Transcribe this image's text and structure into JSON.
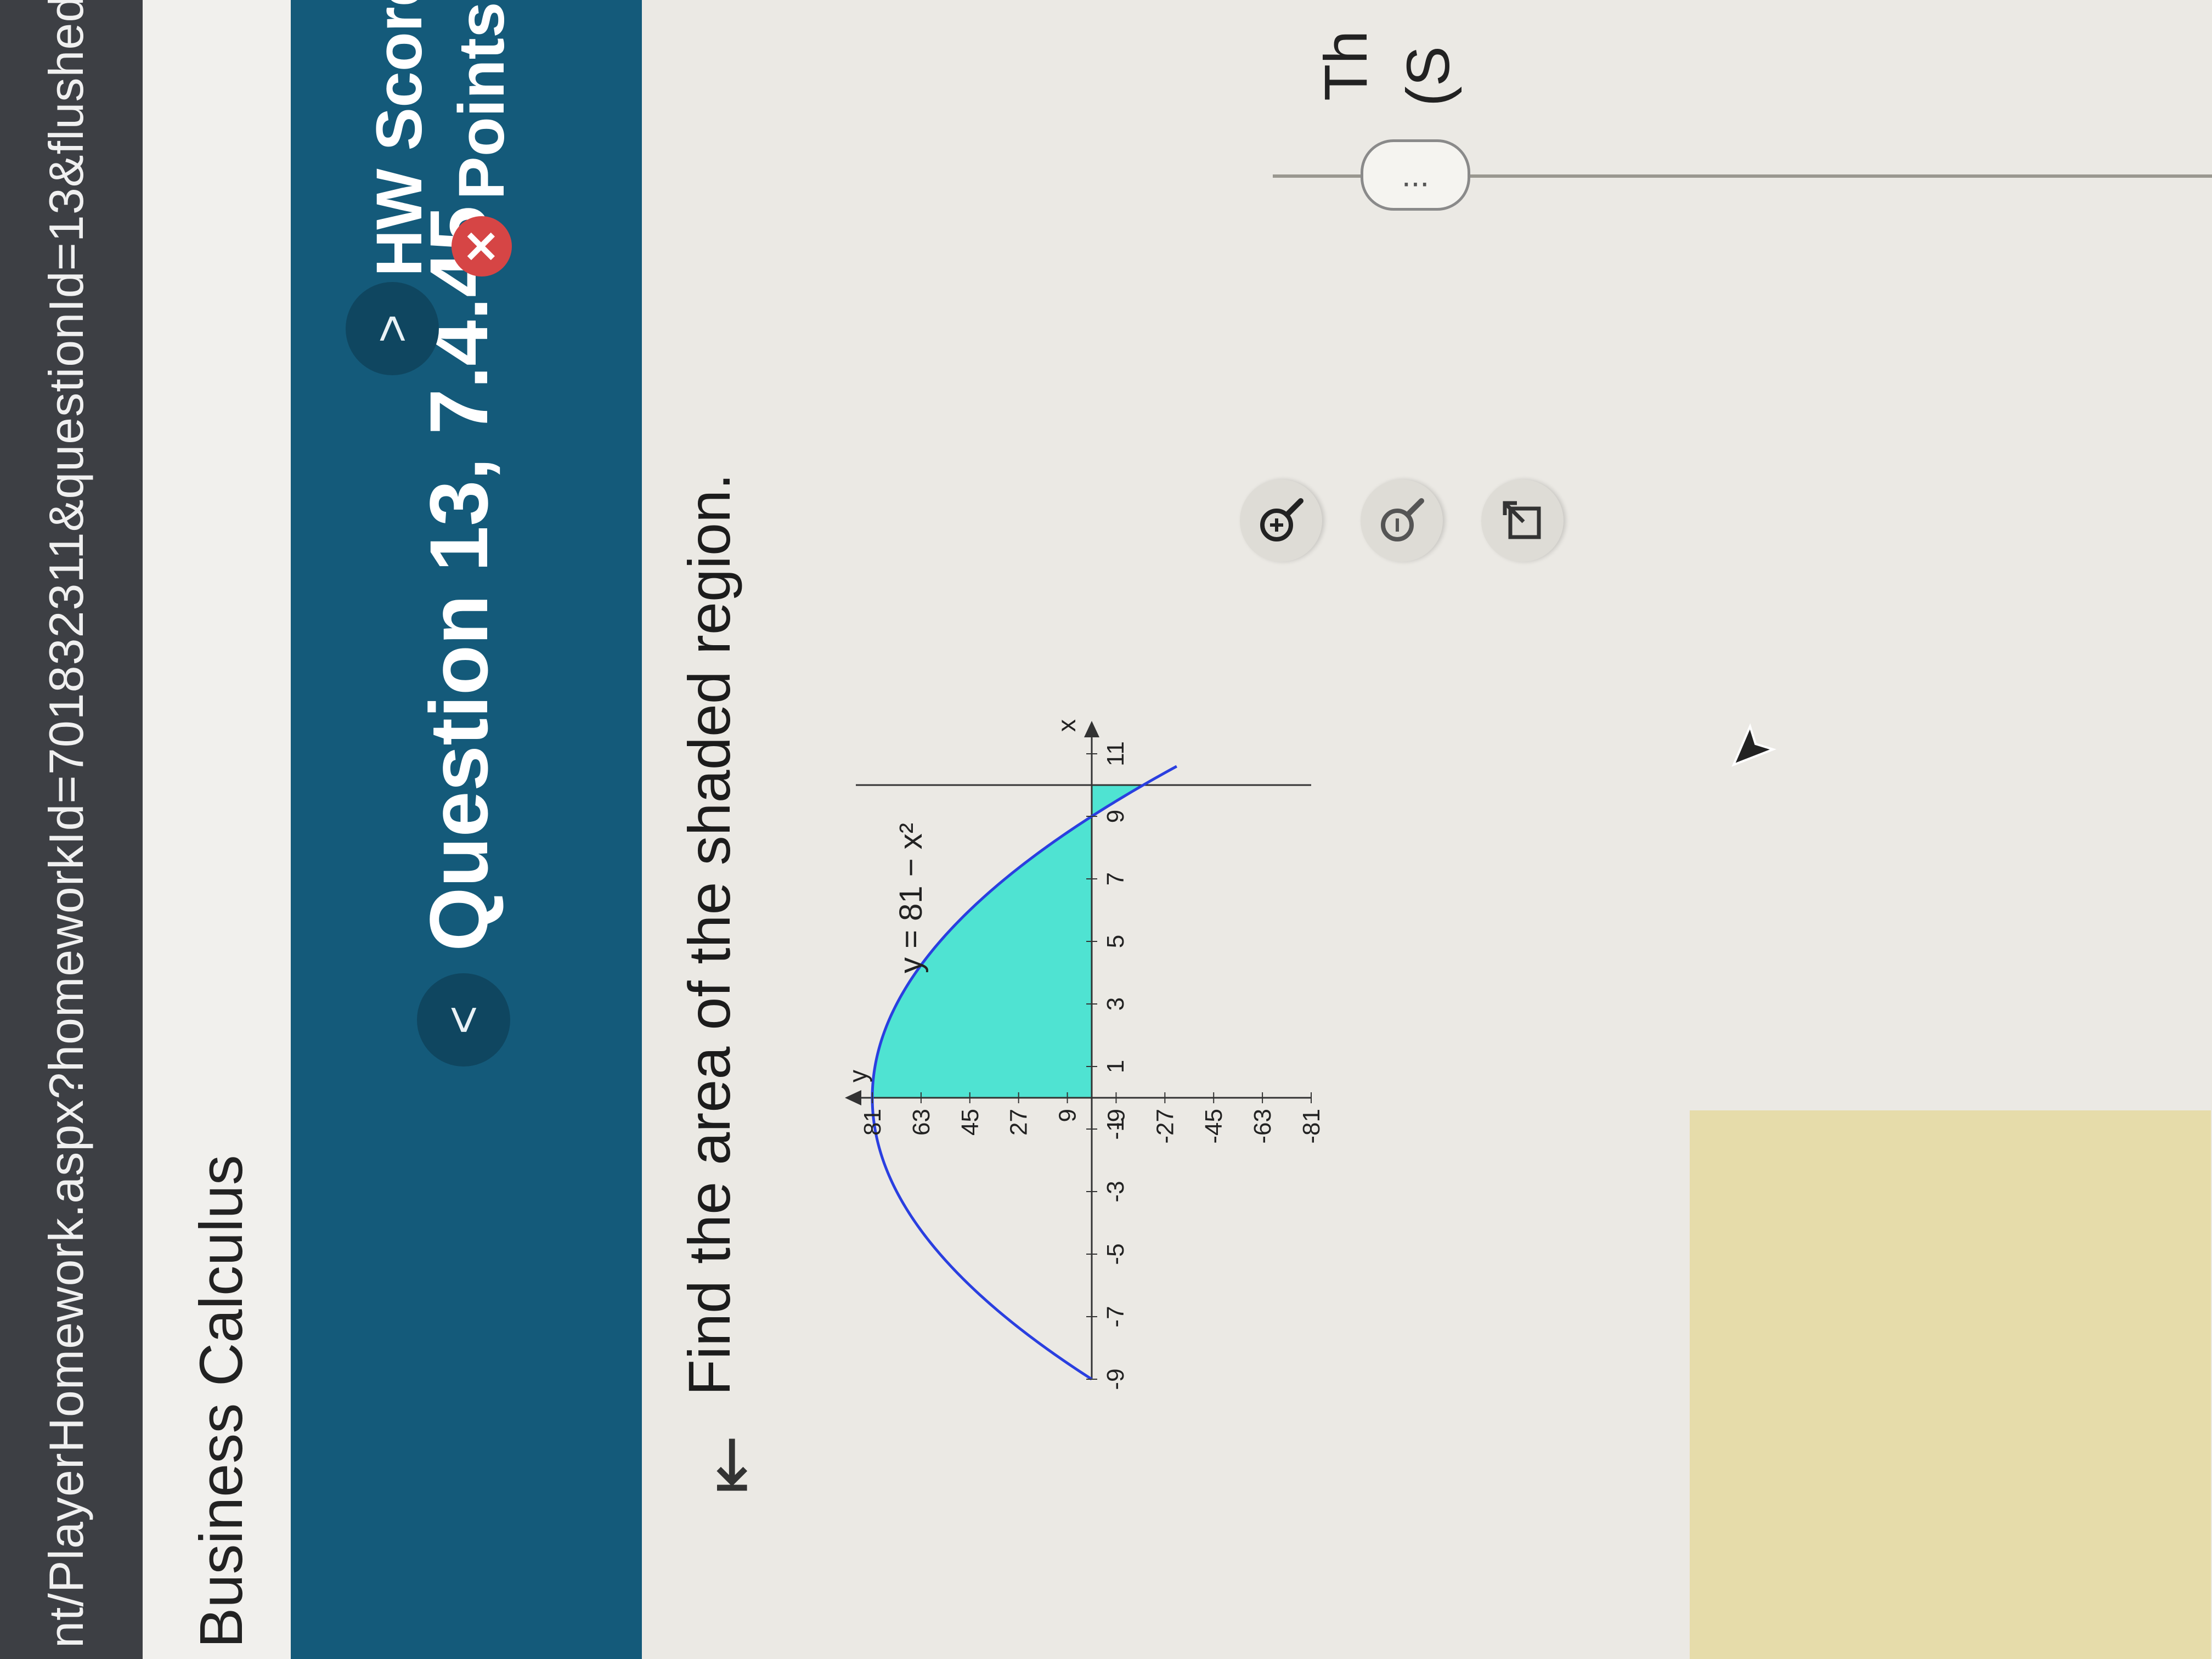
{
  "browser": {
    "url": "nt/PlayerHomework.aspx?homeworkId=701832311&questionId=13&flushed"
  },
  "course": {
    "title": "Business Calculus"
  },
  "question_bar": {
    "title": "Question 13, 7.4.45",
    "prev_label": "<",
    "next_label": ">",
    "hw_score_label": "HW Score",
    "points_label": "Points"
  },
  "question": {
    "prompt": "Find the area of the shaded region.",
    "equation": "y = 81 − x²"
  },
  "right_panel": {
    "title": "Th",
    "subtitle": "(S"
  },
  "more_button": {
    "label": "..."
  },
  "chart_data": {
    "type": "area",
    "function": "y = 81 - x^2",
    "xlabel": "x",
    "ylabel": "y",
    "xlim": [
      -9,
      11
    ],
    "ylim": [
      -81,
      81
    ],
    "x_ticks": [
      "-9",
      "-7",
      "-5",
      "-3",
      "-1",
      "1",
      "3",
      "5",
      "7",
      "9",
      "11"
    ],
    "y_ticks": [
      "81",
      "63",
      "45",
      "27",
      "9",
      "-9",
      "-27",
      "-45",
      "-63",
      "-81"
    ],
    "shaded_interval": [
      0,
      10
    ],
    "vertical_line_x": 10,
    "colors": {
      "fill": "#4fe3d2",
      "curve": "#2a3fe0",
      "axis": "#333333"
    }
  },
  "colors": {
    "header": "#145a7a",
    "url_bar": "#3d3f44",
    "error": "#d64545"
  }
}
